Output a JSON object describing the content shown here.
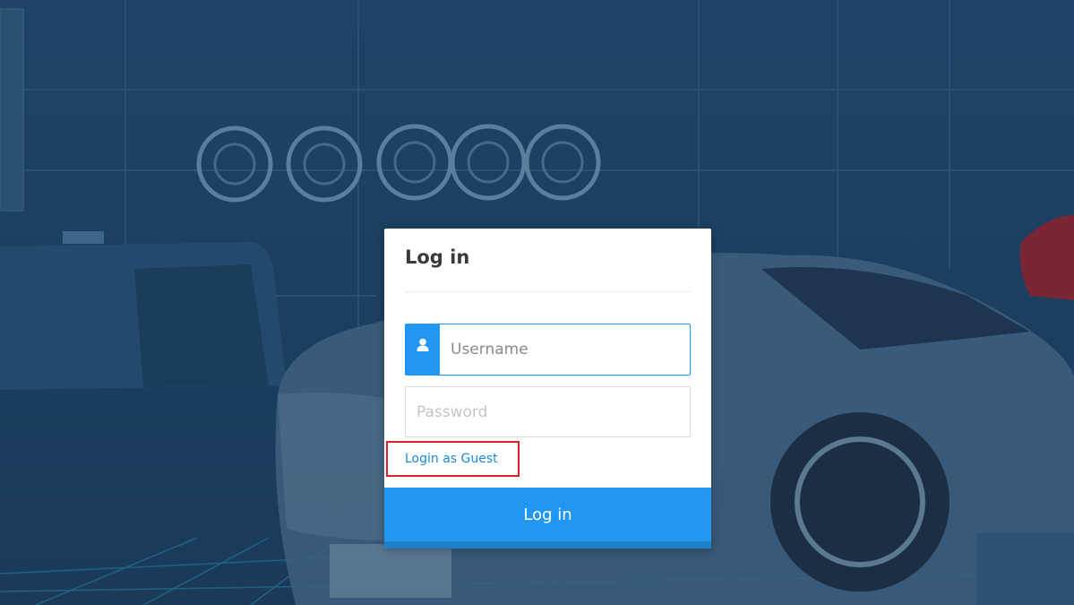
{
  "login": {
    "title": "Log in",
    "username_placeholder": "Username",
    "password_placeholder": "Password",
    "guest_link": "Login as Guest",
    "submit_label": "Log in"
  },
  "icons": {
    "username": "user-icon"
  },
  "colors": {
    "accent": "#2196f3",
    "highlight": "#d9242d",
    "link": "#1a8ad8",
    "background": "#1f4366"
  }
}
